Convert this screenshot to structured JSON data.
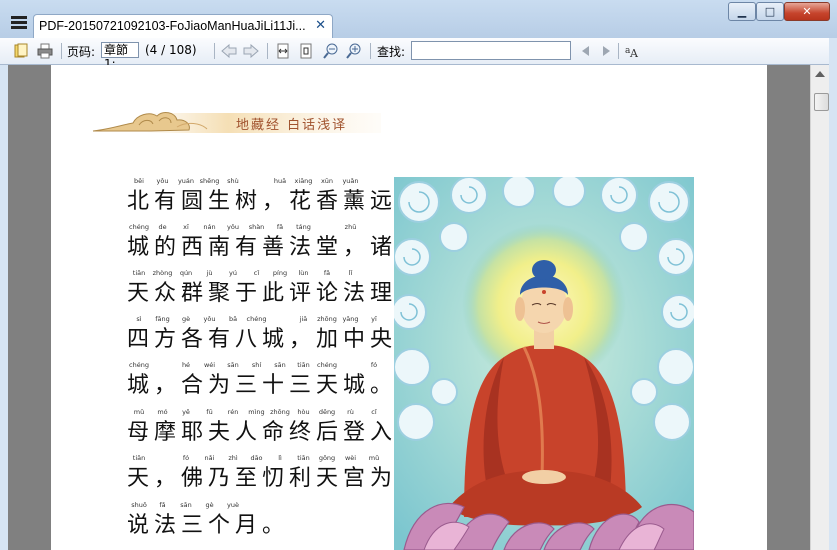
{
  "window": {
    "tab_title": "PDF-20150721092103-FoJiaoManHuaJiLi11Ji...",
    "close_glyph": "✕",
    "minimize_glyph": "▁",
    "maximize_glyph": "□",
    "window_close_glyph": "✕"
  },
  "toolbar": {
    "page_label": "页码:",
    "page_value": "章節1:",
    "page_count": "(4 / 108)",
    "find_label": "查找:",
    "find_value": "",
    "icons": [
      "open-icon",
      "print-icon",
      "prev-page-icon",
      "next-page-icon",
      "fit-width-icon",
      "fit-page-icon",
      "zoom-out-icon",
      "zoom-in-icon",
      "find-prev-icon",
      "find-next-icon",
      "font-size-icon"
    ]
  },
  "page": {
    "banner_text": "地藏经  白话浅译",
    "lines": [
      {
        "pinyin": [
          "běi",
          "yǒu",
          "yuán",
          "shēng",
          "shù",
          "",
          "huā",
          "xiāng",
          "xūn",
          "yuǎn",
          ""
        ],
        "text": "北有圆生树，花香薰远，"
      },
      {
        "pinyin": [
          "chéng",
          "de",
          "xī",
          "nán",
          "yǒu",
          "shàn",
          "fǎ",
          "táng",
          "",
          "zhū"
        ],
        "text": "城的西南有善法堂，诸"
      },
      {
        "pinyin": [
          "tiān",
          "zhòng",
          "qún",
          "jù",
          "yú",
          "cǐ",
          "píng",
          "lùn",
          "fǎ",
          "lǐ"
        ],
        "text": "天众群聚于此评论法理。"
      },
      {
        "pinyin": [
          "sì",
          "fāng",
          "gè",
          "yǒu",
          "bā",
          "chéng",
          "",
          "jiā",
          "zhōng",
          "yāng",
          "yī"
        ],
        "text": "四方各有八城，加中央一"
      },
      {
        "pinyin": [
          "chéng",
          "",
          "hé",
          "wéi",
          "sān",
          "shí",
          "sān",
          "tiān",
          "chéng",
          "",
          "fó"
        ],
        "text": "城，合为三十三天城。佛"
      },
      {
        "pinyin": [
          "mǔ",
          "mó",
          "yē",
          "fū",
          "rén",
          "mìng",
          "zhōng",
          "hòu",
          "dēng",
          "rù",
          "cǐ"
        ],
        "text": "母摩耶夫人命终后登入此"
      },
      {
        "pinyin": [
          "tiān",
          "",
          "fó",
          "nǎi",
          "zhì",
          "dāo",
          "lì",
          "tiān",
          "gōng",
          "wèi",
          "mǔ"
        ],
        "text": "天，佛乃至忉利天宫为母"
      },
      {
        "pinyin": [
          "shuō",
          "fǎ",
          "sān",
          "gè",
          "yuè"
        ],
        "text": "说法三个月。"
      }
    ]
  },
  "colors": {
    "titlebar": "#c9dcf0",
    "robe": "#c8432b",
    "lotus": "#c98ab8",
    "cloud": "#a9d8e4"
  }
}
